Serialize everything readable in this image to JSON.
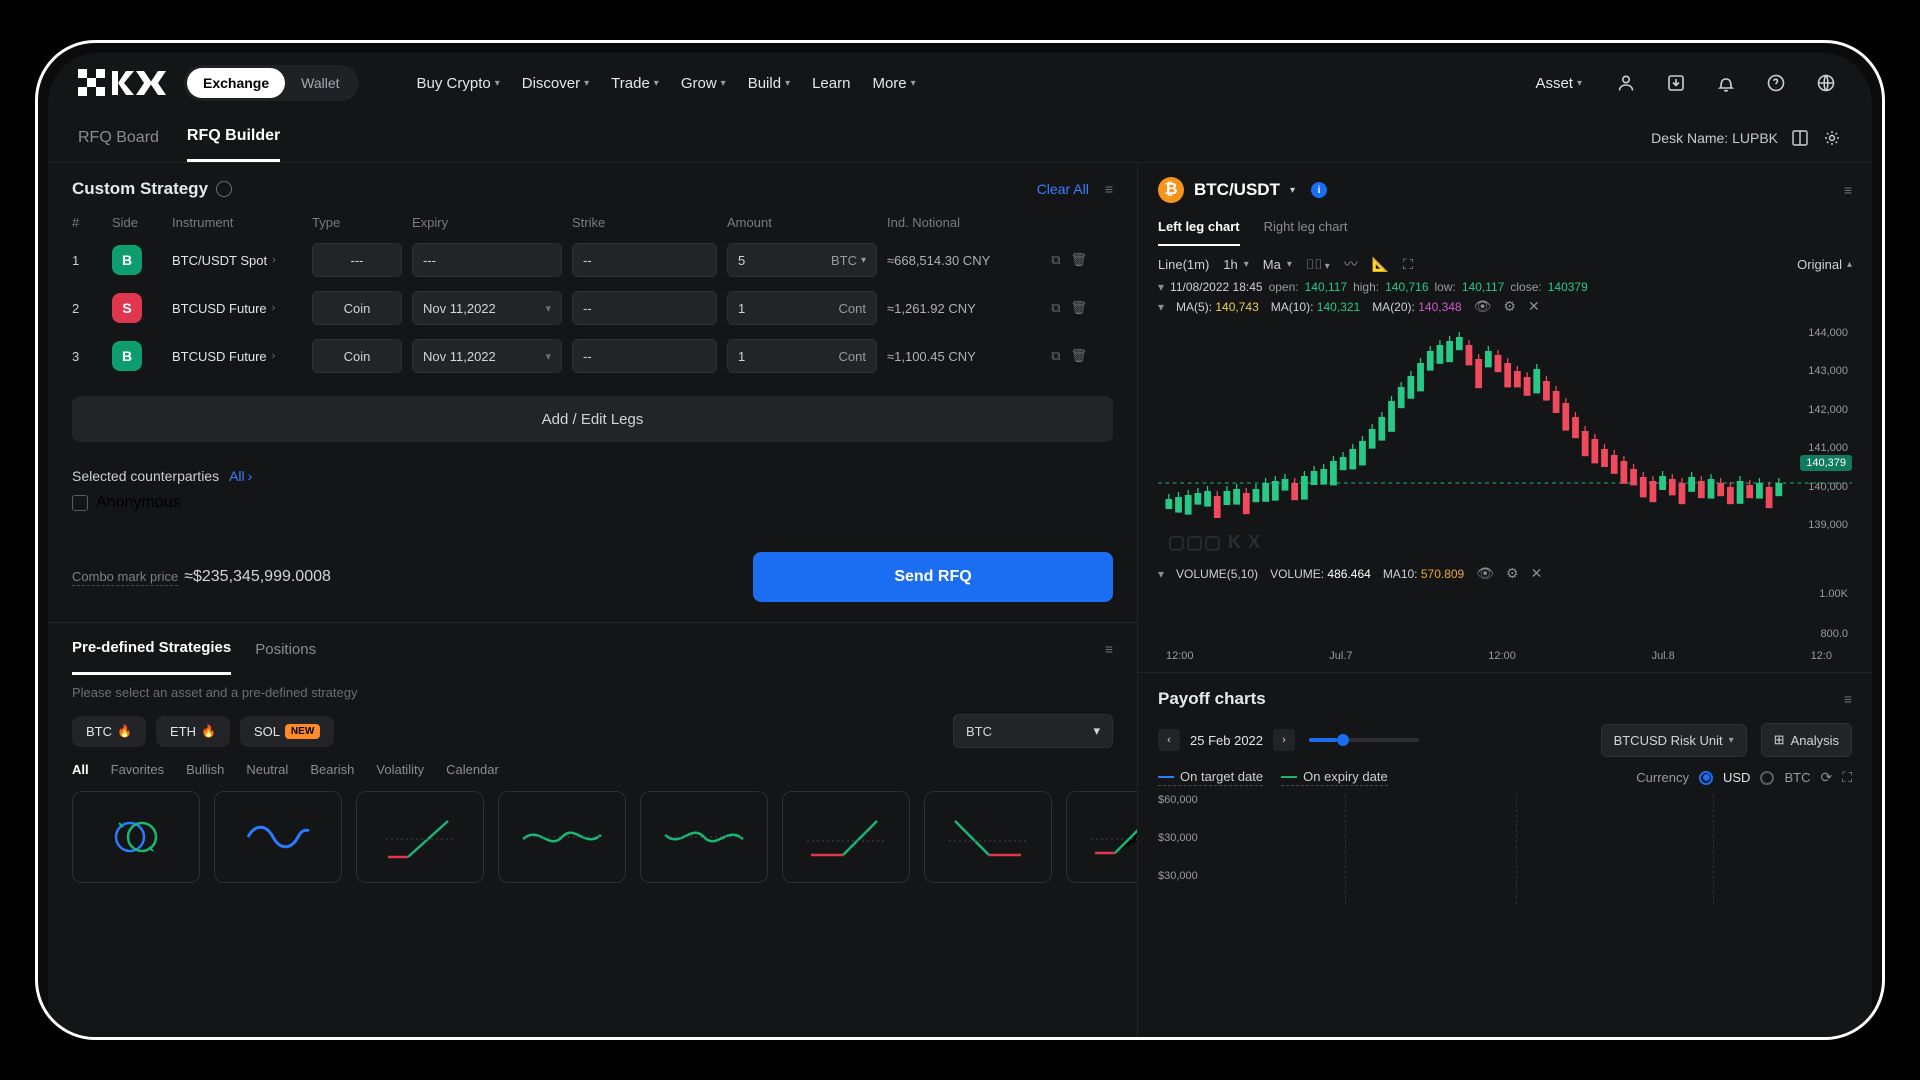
{
  "header": {
    "seg": {
      "exchange": "Exchange",
      "wallet": "Wallet"
    },
    "nav": [
      "Buy Crypto",
      "Discover",
      "Trade",
      "Grow",
      "Build",
      "Learn",
      "More"
    ],
    "asset": "Asset"
  },
  "subtabs": {
    "rfq_board": "RFQ Board",
    "rfq_builder": "RFQ Builder",
    "desk": "Desk Name: LUPBK"
  },
  "strategy": {
    "title": "Custom Strategy",
    "clear": "Clear All",
    "cols": {
      "n": "#",
      "side": "Side",
      "instr": "Instrument",
      "type": "Type",
      "expiry": "Expiry",
      "strike": "Strike",
      "amount": "Amount",
      "notional": "Ind. Notional"
    },
    "legs": [
      {
        "n": "1",
        "side": "B",
        "instr": "BTC/USDT Spot",
        "type": "---",
        "expiry": "---",
        "strike": "--",
        "amount": "5",
        "unit": "BTC",
        "unit_chev": true,
        "notional": "≈668,514.30 CNY"
      },
      {
        "n": "2",
        "side": "S",
        "instr": "BTCUSD Future",
        "type": "Coin",
        "expiry": "Nov 11,2022",
        "strike": "--",
        "amount": "1",
        "unit": "Cont",
        "unit_chev": false,
        "notional": "≈1,261.92 CNY"
      },
      {
        "n": "3",
        "side": "B",
        "instr": "BTCUSD Future",
        "type": "Coin",
        "expiry": "Nov 11,2022",
        "strike": "--",
        "amount": "1",
        "unit": "Cont",
        "unit_chev": false,
        "notional": "≈1,100.45 CNY"
      }
    ],
    "add": "Add / Edit Legs",
    "cp_label": "Selected counterparties",
    "cp_all": "All",
    "anon": "Anonymous",
    "combo_lbl": "Combo mark price",
    "combo_val": "≈$235,345,999.0008",
    "send": "Send RFQ"
  },
  "pair": {
    "name": "BTC/USDT",
    "tabs": {
      "left": "Left leg chart",
      "right": "Right leg chart"
    },
    "tf": {
      "line": "Line(1m)",
      "h1": "1h",
      "ma": "Ma"
    },
    "orig": "Original",
    "ohlc": {
      "ts": "11/08/2022 18:45",
      "open": "open:",
      "openv": "140,117",
      "high": "high:",
      "highv": "140,716",
      "low": "low:",
      "lowv": "140,117",
      "close": "close:",
      "closev": "140379"
    },
    "ma": {
      "ma5l": "MA(5):",
      "ma5": "140,743",
      "ma10l": "MA(10):",
      "ma10": "140,321",
      "ma20l": "MA(20):",
      "ma20": "140,348"
    },
    "ylabels": [
      "144,000",
      "143,000",
      "142,000",
      "141,000",
      "140,000",
      "139,000"
    ],
    "price_tag": "140,379",
    "vol": {
      "ind": "VOLUME(5,10)",
      "vl": "VOLUME:",
      "vv": "486.464",
      "ma10l": "MA10:",
      "ma10": "570.809"
    },
    "vol_y": [
      "1.00K",
      "800.0"
    ],
    "xticks": [
      "12:00",
      "Jul.7",
      "12:00",
      "Jul.8",
      "12:0"
    ]
  },
  "bottom": {
    "tabs": {
      "pre": "Pre-defined Strategies",
      "pos": "Positions"
    },
    "hint": "Please select an asset and a pre-defined strategy",
    "assets": [
      {
        "t": "BTC",
        "flame": true,
        "new": false
      },
      {
        "t": "ETH",
        "flame": true,
        "new": false
      },
      {
        "t": "SOL",
        "flame": false,
        "new": true
      }
    ],
    "sel": "BTC",
    "cats": [
      "All",
      "Favorites",
      "Bullish",
      "Neutral",
      "Bearish",
      "Volatility",
      "Calendar"
    ]
  },
  "payoff": {
    "title": "Payoff charts",
    "date": "25 Feb 2022",
    "risk": "BTCUSD Risk Unit",
    "analysis": "Analysis",
    "legend": {
      "target": "On target date",
      "expiry": "On expiry date"
    },
    "currency_lbl": "Currency",
    "usd": "USD",
    "btc": "BTC",
    "ylabels": [
      "$60,000",
      "$30,000",
      "$30,000"
    ]
  }
}
